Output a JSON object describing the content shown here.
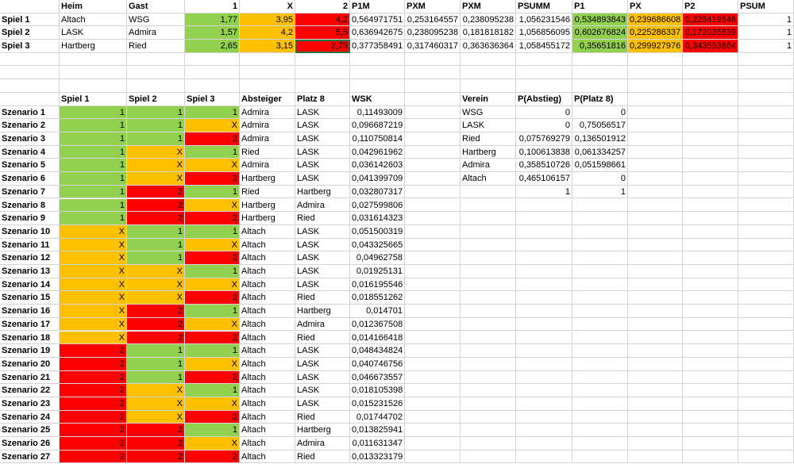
{
  "colors": {
    "green": "#92d050",
    "orange": "#ffc000",
    "red": "#ff0000",
    "grid": "#d4d4d4",
    "selection": "#217346"
  },
  "rows": [
    [
      {
        "t": "",
        "a": "l"
      },
      {
        "t": "Heim",
        "b": 1
      },
      {
        "t": "Gast",
        "b": 1
      },
      {
        "t": "1",
        "b": 1,
        "a": "r"
      },
      {
        "t": "X",
        "b": 1,
        "a": "r"
      },
      {
        "t": "2",
        "b": 1,
        "a": "r"
      },
      {
        "t": "P1M",
        "b": 1
      },
      {
        "t": "PXM",
        "b": 1
      },
      {
        "t": "PXM",
        "b": 1
      },
      {
        "t": "PSUMM",
        "b": 1
      },
      {
        "t": "P1",
        "b": 1
      },
      {
        "t": "PX",
        "b": 1
      },
      {
        "t": "P2",
        "b": 1
      },
      {
        "t": "PSUM",
        "b": 1
      }
    ],
    [
      {
        "t": "Spiel 1",
        "b": 1
      },
      {
        "t": "Altach"
      },
      {
        "t": "WSG"
      },
      {
        "t": "1,77",
        "a": "r",
        "c": "green"
      },
      {
        "t": "3,95",
        "a": "r",
        "c": "orange"
      },
      {
        "t": "4,2",
        "a": "r",
        "c": "red"
      },
      {
        "t": "0,564971751",
        "a": "r"
      },
      {
        "t": "0,253164557",
        "a": "r"
      },
      {
        "t": "0,238095238",
        "a": "r"
      },
      {
        "t": "1,056231546",
        "a": "r"
      },
      {
        "t": "0,534893843",
        "a": "r",
        "c": "green"
      },
      {
        "t": "0,239686608",
        "a": "r",
        "c": "orange"
      },
      {
        "t": "0,225419548",
        "a": "r",
        "c": "red"
      },
      {
        "t": "1",
        "a": "r"
      }
    ],
    [
      {
        "t": "Spiel 2",
        "b": 1
      },
      {
        "t": "LASK"
      },
      {
        "t": "Admira"
      },
      {
        "t": "1,57",
        "a": "r",
        "c": "green"
      },
      {
        "t": "4,2",
        "a": "r",
        "c": "orange"
      },
      {
        "t": "5,5",
        "a": "r",
        "c": "red"
      },
      {
        "t": "0,636942675",
        "a": "r"
      },
      {
        "t": "0,238095238",
        "a": "r"
      },
      {
        "t": "0,181818182",
        "a": "r"
      },
      {
        "t": "1,056856095",
        "a": "r"
      },
      {
        "t": "0,602676824",
        "a": "r",
        "c": "green"
      },
      {
        "t": "0,225286337",
        "a": "r",
        "c": "orange"
      },
      {
        "t": "0,172036839",
        "a": "r",
        "c": "red"
      },
      {
        "t": "1",
        "a": "r"
      }
    ],
    [
      {
        "t": "Spiel 3",
        "b": 1
      },
      {
        "t": "Hartberg"
      },
      {
        "t": "Ried"
      },
      {
        "t": "2,65",
        "a": "r",
        "c": "green"
      },
      {
        "t": "3,15",
        "a": "r",
        "c": "orange"
      },
      {
        "t": "2,75",
        "a": "r",
        "c": "red",
        "s": 1
      },
      {
        "t": "0,377358491",
        "a": "r"
      },
      {
        "t": "0,317460317",
        "a": "r"
      },
      {
        "t": "0,363636364",
        "a": "r"
      },
      {
        "t": "1,058455172",
        "a": "r"
      },
      {
        "t": "0,35651816",
        "a": "r",
        "c": "green"
      },
      {
        "t": "0,299927976",
        "a": "r",
        "c": "orange"
      },
      {
        "t": "0,343553864",
        "a": "r",
        "c": "red"
      },
      {
        "t": "1",
        "a": "r"
      }
    ],
    [],
    [],
    [],
    [
      {
        "t": ""
      },
      {
        "t": "Spiel 1",
        "b": 1
      },
      {
        "t": "Spiel 2",
        "b": 1
      },
      {
        "t": "Spiel 3",
        "b": 1
      },
      {
        "t": "Absteiger",
        "b": 1
      },
      {
        "t": "Platz 8",
        "b": 1
      },
      {
        "t": "WSK",
        "b": 1
      },
      {
        "t": ""
      },
      {
        "t": "Verein",
        "b": 1
      },
      {
        "t": "P(Abstieg)",
        "b": 1
      },
      {
        "t": "P(Platz 8)",
        "b": 1
      }
    ],
    [
      {
        "t": "Szenario 1",
        "b": 1
      },
      {
        "t": "1",
        "a": "r",
        "c": "green"
      },
      {
        "t": "1",
        "a": "r",
        "c": "green"
      },
      {
        "t": "1",
        "a": "r",
        "c": "green"
      },
      {
        "t": "Admira"
      },
      {
        "t": "LASK"
      },
      {
        "t": "0,11493009",
        "a": "r"
      },
      {
        "t": ""
      },
      {
        "t": "WSG"
      },
      {
        "t": "0",
        "a": "r"
      },
      {
        "t": "0",
        "a": "r"
      }
    ],
    [
      {
        "t": "Szenario 2",
        "b": 1
      },
      {
        "t": "1",
        "a": "r",
        "c": "green"
      },
      {
        "t": "1",
        "a": "r",
        "c": "green"
      },
      {
        "t": "X",
        "a": "r",
        "c": "orange"
      },
      {
        "t": "Admira"
      },
      {
        "t": "LASK"
      },
      {
        "t": "0,096687219",
        "a": "r"
      },
      {
        "t": ""
      },
      {
        "t": "LASK"
      },
      {
        "t": "0",
        "a": "r"
      },
      {
        "t": "0,75056517",
        "a": "r"
      }
    ],
    [
      {
        "t": "Szenario 3",
        "b": 1
      },
      {
        "t": "1",
        "a": "r",
        "c": "green"
      },
      {
        "t": "1",
        "a": "r",
        "c": "green"
      },
      {
        "t": "2",
        "a": "r",
        "c": "red"
      },
      {
        "t": "Admira"
      },
      {
        "t": "LASK"
      },
      {
        "t": "0,110750814",
        "a": "r"
      },
      {
        "t": ""
      },
      {
        "t": "Ried"
      },
      {
        "t": "0,075769279",
        "a": "r"
      },
      {
        "t": "0,136501912",
        "a": "r"
      }
    ],
    [
      {
        "t": "Szenario 4",
        "b": 1
      },
      {
        "t": "1",
        "a": "r",
        "c": "green"
      },
      {
        "t": "X",
        "a": "r",
        "c": "orange"
      },
      {
        "t": "1",
        "a": "r",
        "c": "green"
      },
      {
        "t": "Ried"
      },
      {
        "t": "LASK"
      },
      {
        "t": "0,042961962",
        "a": "r"
      },
      {
        "t": ""
      },
      {
        "t": "Hartberg"
      },
      {
        "t": "0,100613838",
        "a": "r"
      },
      {
        "t": "0,061334257",
        "a": "r"
      }
    ],
    [
      {
        "t": "Szenario 5",
        "b": 1
      },
      {
        "t": "1",
        "a": "r",
        "c": "green"
      },
      {
        "t": "X",
        "a": "r",
        "c": "orange"
      },
      {
        "t": "X",
        "a": "r",
        "c": "orange"
      },
      {
        "t": "Admira"
      },
      {
        "t": "LASK"
      },
      {
        "t": "0,036142603",
        "a": "r"
      },
      {
        "t": ""
      },
      {
        "t": "Admira"
      },
      {
        "t": "0,358510726",
        "a": "r"
      },
      {
        "t": "0,051598661",
        "a": "r"
      }
    ],
    [
      {
        "t": "Szenario 6",
        "b": 1
      },
      {
        "t": "1",
        "a": "r",
        "c": "green"
      },
      {
        "t": "X",
        "a": "r",
        "c": "orange"
      },
      {
        "t": "2",
        "a": "r",
        "c": "red"
      },
      {
        "t": "Hartberg"
      },
      {
        "t": "LASK"
      },
      {
        "t": "0,041399709",
        "a": "r"
      },
      {
        "t": ""
      },
      {
        "t": "Altach"
      },
      {
        "t": "0,465106157",
        "a": "r"
      },
      {
        "t": "0",
        "a": "r"
      }
    ],
    [
      {
        "t": "Szenario 7",
        "b": 1
      },
      {
        "t": "1",
        "a": "r",
        "c": "green"
      },
      {
        "t": "2",
        "a": "r",
        "c": "red"
      },
      {
        "t": "1",
        "a": "r",
        "c": "green"
      },
      {
        "t": "Ried"
      },
      {
        "t": "Hartberg"
      },
      {
        "t": "0,032807317",
        "a": "r"
      },
      {
        "t": ""
      },
      {
        "t": ""
      },
      {
        "t": "1",
        "a": "r"
      },
      {
        "t": "1",
        "a": "r"
      }
    ],
    [
      {
        "t": "Szenario 8",
        "b": 1
      },
      {
        "t": "1",
        "a": "r",
        "c": "green"
      },
      {
        "t": "2",
        "a": "r",
        "c": "red"
      },
      {
        "t": "X",
        "a": "r",
        "c": "orange"
      },
      {
        "t": "Hartberg"
      },
      {
        "t": "Admira"
      },
      {
        "t": "0,027599806",
        "a": "r"
      }
    ],
    [
      {
        "t": "Szenario 9",
        "b": 1
      },
      {
        "t": "1",
        "a": "r",
        "c": "green"
      },
      {
        "t": "2",
        "a": "r",
        "c": "red"
      },
      {
        "t": "2",
        "a": "r",
        "c": "red"
      },
      {
        "t": "Hartberg"
      },
      {
        "t": "Ried"
      },
      {
        "t": "0,031614323",
        "a": "r"
      }
    ],
    [
      {
        "t": "Szenario 10",
        "b": 1
      },
      {
        "t": "X",
        "a": "r",
        "c": "orange"
      },
      {
        "t": "1",
        "a": "r",
        "c": "green"
      },
      {
        "t": "1",
        "a": "r",
        "c": "green"
      },
      {
        "t": "Altach"
      },
      {
        "t": "LASK"
      },
      {
        "t": "0,051500319",
        "a": "r"
      }
    ],
    [
      {
        "t": "Szenario 11",
        "b": 1
      },
      {
        "t": "X",
        "a": "r",
        "c": "orange"
      },
      {
        "t": "1",
        "a": "r",
        "c": "green"
      },
      {
        "t": "X",
        "a": "r",
        "c": "orange"
      },
      {
        "t": "Altach"
      },
      {
        "t": "LASK"
      },
      {
        "t": "0,043325665",
        "a": "r"
      }
    ],
    [
      {
        "t": "Szenario 12",
        "b": 1
      },
      {
        "t": "X",
        "a": "r",
        "c": "orange"
      },
      {
        "t": "1",
        "a": "r",
        "c": "green"
      },
      {
        "t": "2",
        "a": "r",
        "c": "red"
      },
      {
        "t": "Altach"
      },
      {
        "t": "LASK"
      },
      {
        "t": "0,04962758",
        "a": "r"
      }
    ],
    [
      {
        "t": "Szenario 13",
        "b": 1
      },
      {
        "t": "X",
        "a": "r",
        "c": "orange"
      },
      {
        "t": "X",
        "a": "r",
        "c": "orange"
      },
      {
        "t": "1",
        "a": "r",
        "c": "green"
      },
      {
        "t": "Altach"
      },
      {
        "t": "LASK"
      },
      {
        "t": "0,01925131",
        "a": "r"
      }
    ],
    [
      {
        "t": "Szenario 14",
        "b": 1
      },
      {
        "t": "X",
        "a": "r",
        "c": "orange"
      },
      {
        "t": "X",
        "a": "r",
        "c": "orange"
      },
      {
        "t": "X",
        "a": "r",
        "c": "orange"
      },
      {
        "t": "Altach"
      },
      {
        "t": "LASK"
      },
      {
        "t": "0,016195546",
        "a": "r"
      }
    ],
    [
      {
        "t": "Szenario 15",
        "b": 1
      },
      {
        "t": "X",
        "a": "r",
        "c": "orange"
      },
      {
        "t": "X",
        "a": "r",
        "c": "orange"
      },
      {
        "t": "2",
        "a": "r",
        "c": "red"
      },
      {
        "t": "Altach"
      },
      {
        "t": "Ried"
      },
      {
        "t": "0,018551262",
        "a": "r"
      }
    ],
    [
      {
        "t": "Szenario 16",
        "b": 1
      },
      {
        "t": "X",
        "a": "r",
        "c": "orange"
      },
      {
        "t": "2",
        "a": "r",
        "c": "red"
      },
      {
        "t": "1",
        "a": "r",
        "c": "green"
      },
      {
        "t": "Altach"
      },
      {
        "t": "Hartberg"
      },
      {
        "t": "0,014701",
        "a": "r"
      }
    ],
    [
      {
        "t": "Szenario 17",
        "b": 1
      },
      {
        "t": "X",
        "a": "r",
        "c": "orange"
      },
      {
        "t": "2",
        "a": "r",
        "c": "red"
      },
      {
        "t": "X",
        "a": "r",
        "c": "orange"
      },
      {
        "t": "Altach"
      },
      {
        "t": "Admira"
      },
      {
        "t": "0,012367508",
        "a": "r"
      }
    ],
    [
      {
        "t": "Szenario 18",
        "b": 1
      },
      {
        "t": "X",
        "a": "r",
        "c": "orange"
      },
      {
        "t": "2",
        "a": "r",
        "c": "red"
      },
      {
        "t": "2",
        "a": "r",
        "c": "red"
      },
      {
        "t": "Altach"
      },
      {
        "t": "Ried"
      },
      {
        "t": "0,014166418",
        "a": "r"
      }
    ],
    [
      {
        "t": "Szenario 19",
        "b": 1
      },
      {
        "t": "2",
        "a": "r",
        "c": "red"
      },
      {
        "t": "1",
        "a": "r",
        "c": "green"
      },
      {
        "t": "1",
        "a": "r",
        "c": "green"
      },
      {
        "t": "Altach"
      },
      {
        "t": "LASK"
      },
      {
        "t": "0,048434824",
        "a": "r"
      }
    ],
    [
      {
        "t": "Szenario 20",
        "b": 1
      },
      {
        "t": "2",
        "a": "r",
        "c": "red"
      },
      {
        "t": "1",
        "a": "r",
        "c": "green"
      },
      {
        "t": "X",
        "a": "r",
        "c": "orange"
      },
      {
        "t": "Altach"
      },
      {
        "t": "LASK"
      },
      {
        "t": "0,040746756",
        "a": "r"
      }
    ],
    [
      {
        "t": "Szenario 21",
        "b": 1
      },
      {
        "t": "2",
        "a": "r",
        "c": "red"
      },
      {
        "t": "1",
        "a": "r",
        "c": "green"
      },
      {
        "t": "2",
        "a": "r",
        "c": "red"
      },
      {
        "t": "Altach"
      },
      {
        "t": "LASK"
      },
      {
        "t": "0,046673557",
        "a": "r"
      }
    ],
    [
      {
        "t": "Szenario 22",
        "b": 1
      },
      {
        "t": "2",
        "a": "r",
        "c": "red"
      },
      {
        "t": "X",
        "a": "r",
        "c": "orange"
      },
      {
        "t": "1",
        "a": "r",
        "c": "green"
      },
      {
        "t": "Altach"
      },
      {
        "t": "LASK"
      },
      {
        "t": "0,018105398",
        "a": "r"
      }
    ],
    [
      {
        "t": "Szenario 23",
        "b": 1
      },
      {
        "t": "2",
        "a": "r",
        "c": "red"
      },
      {
        "t": "X",
        "a": "r",
        "c": "orange"
      },
      {
        "t": "X",
        "a": "r",
        "c": "orange"
      },
      {
        "t": "Altach"
      },
      {
        "t": "LASK"
      },
      {
        "t": "0,015231526",
        "a": "r"
      }
    ],
    [
      {
        "t": "Szenario 24",
        "b": 1
      },
      {
        "t": "2",
        "a": "r",
        "c": "red"
      },
      {
        "t": "X",
        "a": "r",
        "c": "orange"
      },
      {
        "t": "2",
        "a": "r",
        "c": "red"
      },
      {
        "t": "Altach"
      },
      {
        "t": "Ried"
      },
      {
        "t": "0,01744702",
        "a": "r"
      }
    ],
    [
      {
        "t": "Szenario 25",
        "b": 1
      },
      {
        "t": "2",
        "a": "r",
        "c": "red"
      },
      {
        "t": "2",
        "a": "r",
        "c": "red"
      },
      {
        "t": "1",
        "a": "r",
        "c": "green"
      },
      {
        "t": "Altach"
      },
      {
        "t": "Hartberg"
      },
      {
        "t": "0,013825941",
        "a": "r"
      }
    ],
    [
      {
        "t": "Szenario 26",
        "b": 1
      },
      {
        "t": "2",
        "a": "r",
        "c": "red"
      },
      {
        "t": "2",
        "a": "r",
        "c": "red"
      },
      {
        "t": "X",
        "a": "r",
        "c": "orange"
      },
      {
        "t": "Altach"
      },
      {
        "t": "Admira"
      },
      {
        "t": "0,011631347",
        "a": "r"
      }
    ],
    [
      {
        "t": "Szenario 27",
        "b": 1
      },
      {
        "t": "2",
        "a": "r",
        "c": "red"
      },
      {
        "t": "2",
        "a": "r",
        "c": "red"
      },
      {
        "t": "2",
        "a": "r",
        "c": "red"
      },
      {
        "t": "Altach"
      },
      {
        "t": "Ried"
      },
      {
        "t": "0,013323179",
        "a": "r"
      }
    ]
  ]
}
